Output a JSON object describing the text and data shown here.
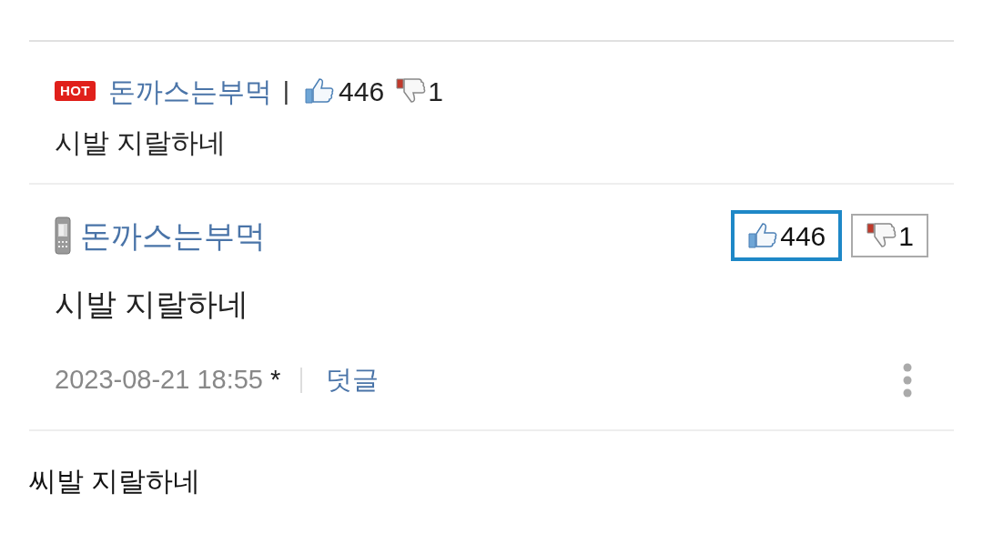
{
  "hot_comment": {
    "badge": "HOT",
    "author": "돈까스는부먹",
    "separator": "|",
    "likes": "446",
    "dislikes": "1",
    "text": "시발 지랄하네"
  },
  "comment": {
    "author": "돈까스는부먹",
    "votes": [
      {
        "kind": "up",
        "count": "446",
        "selected": true
      },
      {
        "kind": "down",
        "count": "1",
        "selected": false
      }
    ],
    "text": "시발 지랄하네",
    "date": "2023-08-21 18:55",
    "edited_mark": "*",
    "reply_link": "덧글"
  },
  "body_text": "씨발 지랄하네"
}
